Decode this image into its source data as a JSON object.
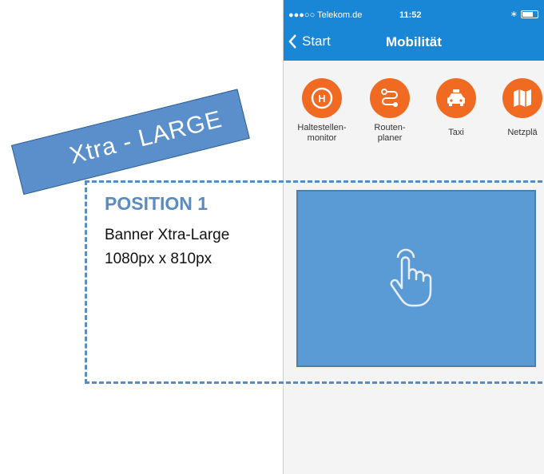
{
  "status": {
    "carrier": "●●●○○ Telekom.de",
    "time": "11:52"
  },
  "nav": {
    "back_label": "Start",
    "title": "Mobilität"
  },
  "icons": [
    {
      "name": "bus-stop-icon",
      "label": "Haltestellen-\nmonitor"
    },
    {
      "name": "route-icon",
      "label": "Routen-\nplaner"
    },
    {
      "name": "taxi-icon",
      "label": "Taxi"
    },
    {
      "name": "map-icon",
      "label": "Netzplä"
    }
  ],
  "annotation": {
    "ribbon": "Xtra - LARGE",
    "position": "POSITION 1",
    "line1": "Banner Xtra-Large",
    "line2": "1080px x 810px"
  },
  "colors": {
    "accent": "#1a86d6",
    "icon_bg": "#f16a22",
    "banner": "#5b9bd5",
    "annotation": "#5b8bbf"
  }
}
